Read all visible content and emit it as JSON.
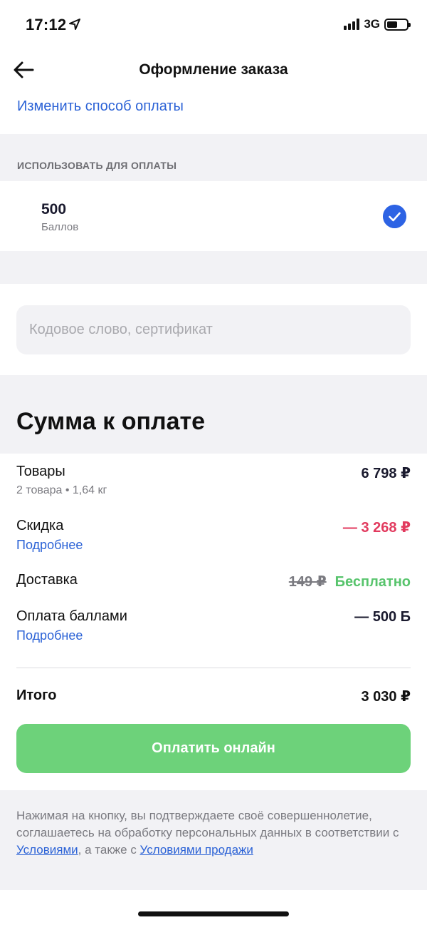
{
  "status_bar": {
    "time": "17:12",
    "network": "3G"
  },
  "nav": {
    "title": "Оформление заказа"
  },
  "payment": {
    "change_link": "Изменить способ оплаты",
    "use_caption": "ИСПОЛЬЗОВАТЬ ДЛЯ ОПЛАТЫ",
    "points_value": "500",
    "points_label": "Баллов",
    "points_selected": true
  },
  "promo": {
    "placeholder": "Кодовое слово, сертификат"
  },
  "summary": {
    "title": "Сумма к оплате",
    "goods_label": "Товары",
    "goods_sub": "2 товара  •  1,64 кг",
    "goods_value": "6 798 ₽",
    "discount_label": "Скидка",
    "discount_link": "Подробнее",
    "discount_value": "— 3 268 ₽",
    "delivery_label": "Доставка",
    "delivery_old": "149 ₽",
    "delivery_value": "Бесплатно",
    "points_pay_label": "Оплата баллами",
    "points_pay_link": "Подробнее",
    "points_pay_value": "— 500 Б",
    "total_label": "Итого",
    "total_value": "3 030 ₽"
  },
  "actions": {
    "pay_button": "Оплатить онлайн"
  },
  "legal": {
    "text_part1": "Нажимая на кнопку, вы подтверждаете своё совершеннолетие, соглашаетесь на обработку персональных данных в соответствии с ",
    "terms_link": "Условиями",
    "text_part2": ", а также с ",
    "sale_terms_link": "Условиями продажи"
  },
  "colors": {
    "accent_blue": "#2b62d6",
    "pay_green": "#6dd27a",
    "discount_red": "#e23a5e",
    "free_green": "#57c46c",
    "band_gray": "#f2f2f5"
  }
}
